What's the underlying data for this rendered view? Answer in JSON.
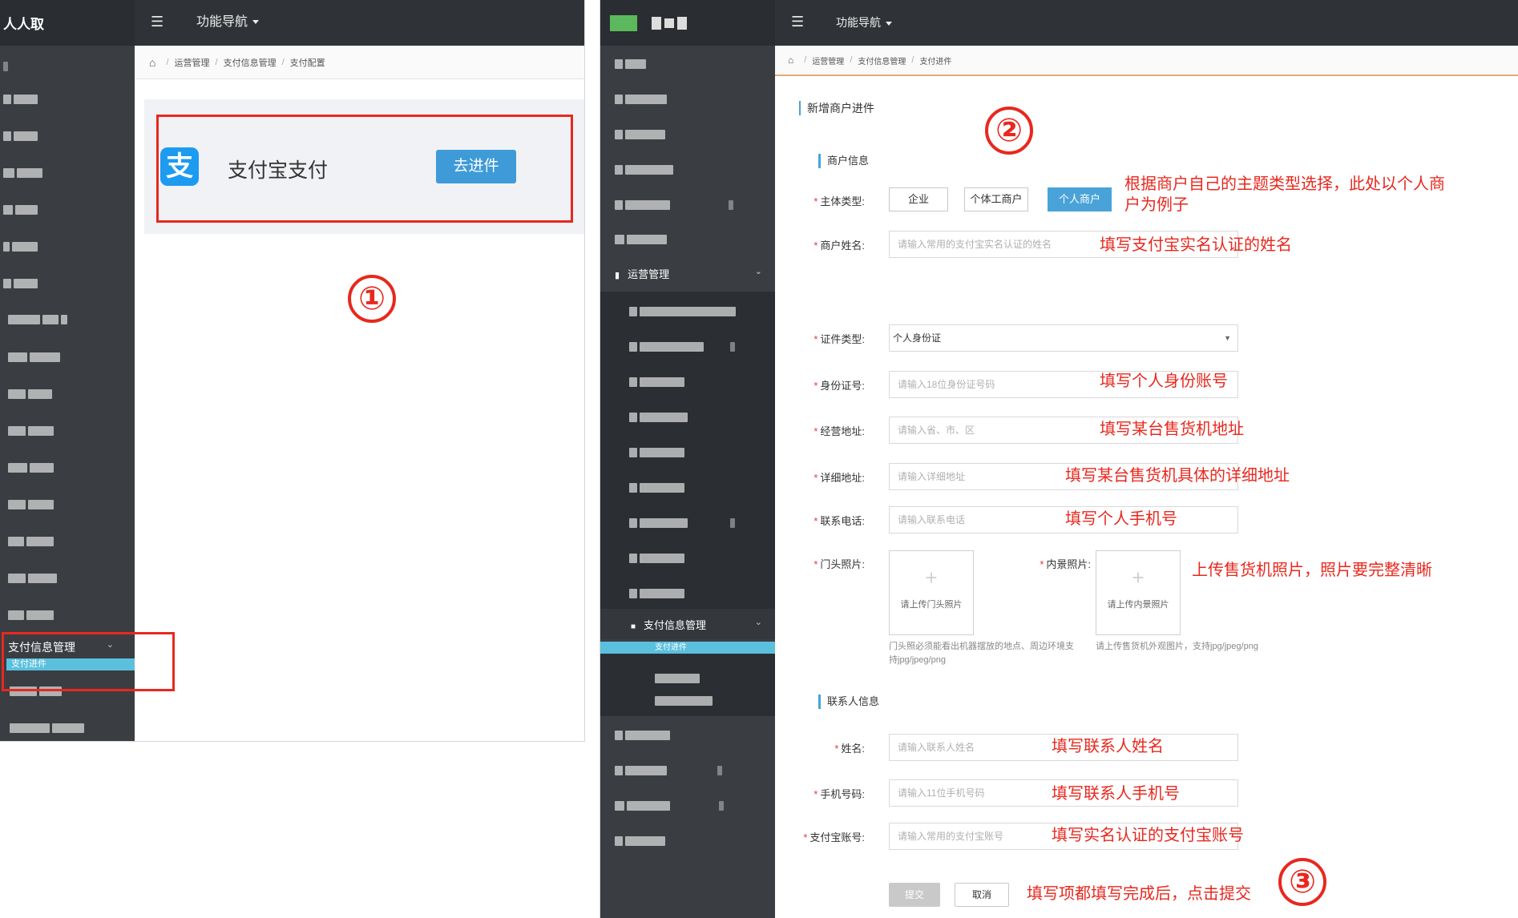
{
  "left": {
    "brand": "人人取",
    "nav_label": "功能导航",
    "breadcrumb": [
      "运营管理",
      "支付信息管理",
      "支付配置"
    ],
    "card": {
      "title": "支付宝支付",
      "button": "去进件"
    },
    "sidebar": {
      "group": "支付信息管理",
      "active_item": "支付进件"
    },
    "step": "①"
  },
  "right": {
    "nav_label": "功能导航",
    "breadcrumb": [
      "运营管理",
      "支付信息管理",
      "支付进件"
    ],
    "sidebar": {
      "group_ops": "运营管理",
      "group_pay": "支付信息管理",
      "active_item": "支付进件"
    },
    "page_title": "新增商户进件",
    "step2": "②",
    "step3": "③",
    "sections": {
      "merchant": "商户信息",
      "contact": "联系人信息"
    },
    "labels": {
      "subject_type": "主体类型:",
      "merchant_name": "商户姓名:",
      "cert_type": "证件类型:",
      "id_number": "身份证号:",
      "biz_address": "经营地址:",
      "detail_address": "详细地址:",
      "phone": "联系电话:",
      "door_photo": "门头照片:",
      "interior_photo": "内景照片:",
      "contact_name": "姓名:",
      "contact_mobile": "手机号码:",
      "alipay_account": "支付宝账号:"
    },
    "subject_options": [
      "企业",
      "个体工商户",
      "个人商户"
    ],
    "subject_selected": "个人商户",
    "cert_value": "个人身份证",
    "placeholders": {
      "merchant_name": "请输入常用的支付宝实名认证的姓名",
      "id_number": "请输入18位身份证号码",
      "biz_address": "请输入省、市、区",
      "detail_address": "请输入详细地址",
      "phone": "请输入联系电话",
      "contact_name": "请输入联系人姓名",
      "contact_mobile": "请输入11位手机号码",
      "alipay_account": "请输入常用的支付宝账号"
    },
    "upload": {
      "door_text": "请上传门头照片",
      "interior_text": "请上传内景照片",
      "door_hint": "门头照必须能看出机器摆放的地点、周边环境支持jpg/jpeg/png",
      "interior_hint": "请上传售货机外观图片，支持jpg/jpeg/png"
    },
    "buttons": {
      "submit": "提交",
      "cancel": "取消"
    },
    "annotations": {
      "subject": "根据商户自己的主题类型选择，此处以个人商户为例子",
      "merchant_name": "填写支付宝实名认证的姓名",
      "id_number": "填写个人身份账号",
      "biz_address": "填写某台售货机地址",
      "detail_address": "填写某台售货机具体的详细地址",
      "phone": "填写个人手机号",
      "photos": "上传售货机照片，照片要完整清晰",
      "contact_name": "填写联系人姓名",
      "contact_mobile": "填写联系人手机号",
      "alipay_account": "填写实名认证的支付宝账号",
      "submit": "填写项都填写完成后，点击提交"
    }
  },
  "colors": {
    "annotation_red": "#e8281e",
    "accent_blue": "#4aa3d8",
    "sidebar_dark": "#3a3d42",
    "topbar": "#2f3236"
  }
}
